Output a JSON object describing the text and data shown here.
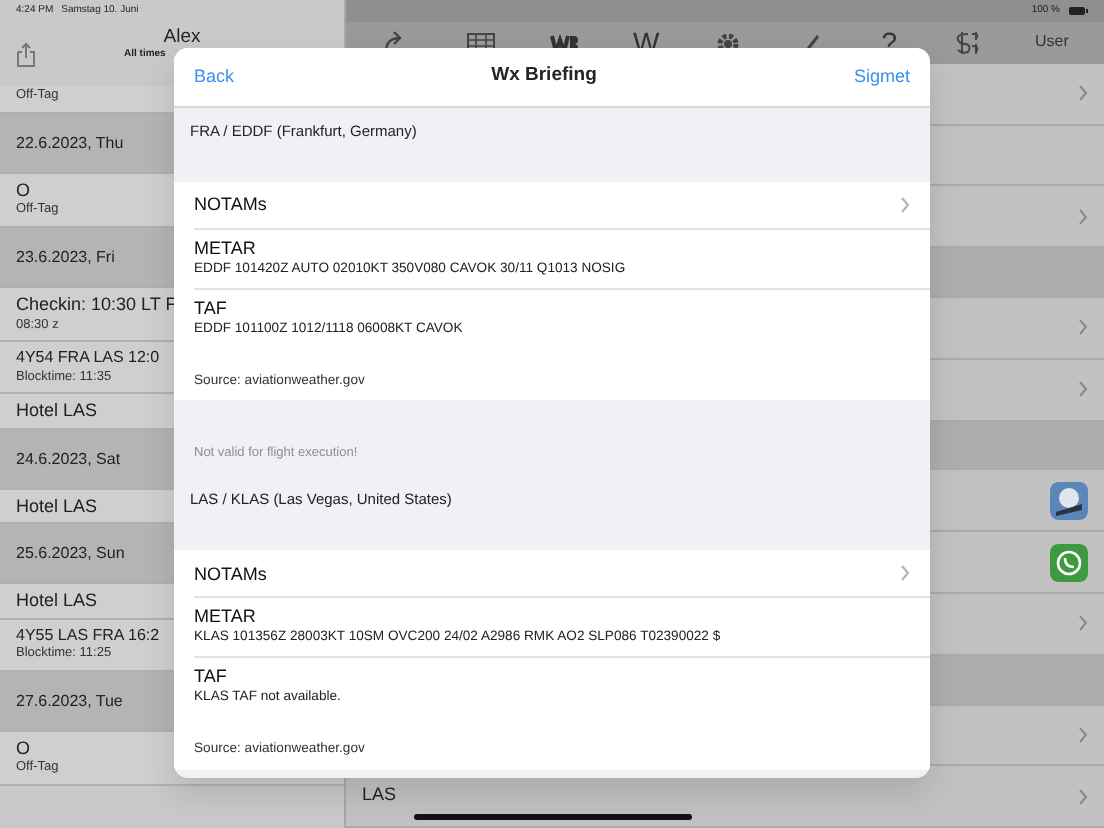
{
  "status_bar": {
    "time": "4:24 PM",
    "date": "Samstag 10. Juni",
    "battery": "100 %"
  },
  "left_panel": {
    "title": "Alex",
    "subtitle": "All times",
    "rows": [
      {
        "kind": "item",
        "subtitle": "Off-Tag"
      },
      {
        "kind": "header",
        "title": "22.6.2023, Thu"
      },
      {
        "kind": "item",
        "title": "O",
        "subtitle": "Off-Tag"
      },
      {
        "kind": "header",
        "title": "23.6.2023, Fri"
      },
      {
        "kind": "item",
        "title": "Checkin: 10:30 LT F",
        "subtitle": "08:30 z"
      },
      {
        "kind": "item",
        "title": "4Y54 FRA LAS 12:0",
        "subtitle": "Blocktime: 11:35"
      },
      {
        "kind": "item",
        "title": "Hotel LAS"
      },
      {
        "kind": "header",
        "title": "24.6.2023, Sat"
      },
      {
        "kind": "item",
        "title": "Hotel LAS"
      },
      {
        "kind": "header",
        "title": "25.6.2023, Sun"
      },
      {
        "kind": "item",
        "title": "Hotel LAS"
      },
      {
        "kind": "item",
        "title": "4Y55 LAS FRA 16:2",
        "subtitle": "Blocktime: 11:25"
      },
      {
        "kind": "header",
        "title": "27.6.2023, Tue"
      },
      {
        "kind": "item",
        "title": "O",
        "subtitle": "Off-Tag"
      }
    ]
  },
  "toolbar": [
    {
      "kind": "redo"
    },
    {
      "kind": "table"
    },
    {
      "kind": "wb"
    },
    {
      "kind": "text",
      "text": "W"
    },
    {
      "kind": "gear"
    },
    {
      "kind": "pen"
    },
    {
      "kind": "text",
      "text": "?"
    },
    {
      "kind": "dollar"
    },
    {
      "kind": "link",
      "text": "User"
    }
  ],
  "right_panel": {
    "rows": [
      {
        "kind": "chevron"
      },
      {
        "kind": "plain"
      },
      {
        "kind": "chevron"
      },
      {
        "kind": "section"
      },
      {
        "kind": "chevron"
      },
      {
        "kind": "chevron"
      },
      {
        "kind": "section"
      },
      {
        "kind": "app-photo"
      },
      {
        "kind": "app-phone"
      },
      {
        "kind": "chevron"
      },
      {
        "kind": "section"
      },
      {
        "kind": "chevron"
      },
      {
        "kind": "chevron",
        "title": "LAS"
      }
    ]
  },
  "modal": {
    "title": "Wx Briefing",
    "back": "Back",
    "action": "Sigmet",
    "sections": [
      {
        "airport": "FRA / EDDF (Frankfurt, Germany)",
        "rows": [
          {
            "kind": "link",
            "title": "NOTAMs"
          },
          {
            "kind": "report",
            "title": "METAR",
            "text": "EDDF 101420Z AUTO 02010KT 350V080 CAVOK 30/11 Q1013 NOSIG"
          },
          {
            "kind": "report",
            "title": "TAF",
            "text": "EDDF 101100Z 1012/1118 06008KT CAVOK",
            "source": "Source: aviationweather.gov"
          }
        ],
        "footer": "Not valid for flight execution!"
      },
      {
        "airport": "LAS / KLAS (Las Vegas, United States)",
        "rows": [
          {
            "kind": "link",
            "title": "NOTAMs"
          },
          {
            "kind": "report",
            "title": "METAR",
            "text": "KLAS 101356Z 28003KT 10SM OVC200 24/02 A2986 RMK AO2 SLP086 T02390022 $"
          },
          {
            "kind": "report",
            "title": "TAF",
            "text": "KLAS TAF not available.",
            "source": "Source: aviationweather.gov"
          }
        ]
      }
    ]
  }
}
